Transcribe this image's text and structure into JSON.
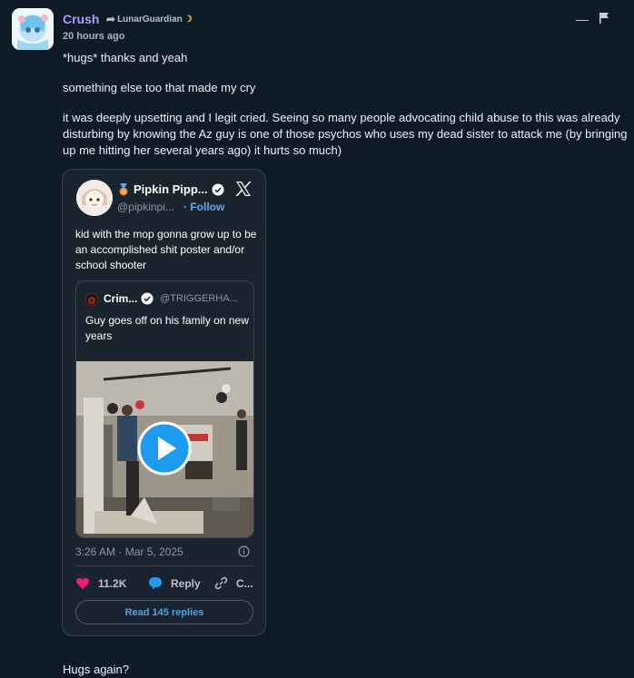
{
  "post": {
    "author": "Crush",
    "reply_to": "LunarGuardian",
    "timestamp": "20 hours ago",
    "messages": [
      "*hugs* thanks and yeah",
      "something else too that made my cry",
      "it was deeply upsetting and I legit cried. Seeing so many people advocating child abuse to this was already disturbing by knowing the Az guy is one of those psychos who uses my dead sister to attack me (by bringing up me hitting her several years ago) it hurts so much)",
      "Hugs again?"
    ],
    "icons": [
      "reply-arrow-icon",
      "moon-icon",
      "minimize-icon",
      "flag-icon"
    ]
  },
  "embed": {
    "name": "Pipkin Pipp...",
    "handle": "@pipkinpi...",
    "follow_label": "· Follow",
    "text": "kid with the mop gonna grow up to be an accomplished shit poster and/or school shooter",
    "quote": {
      "name": "Crim...",
      "handle": "@TRIGGERHA...",
      "text": "Guy goes off on his family on new years"
    },
    "timestamp": "3:26 AM · Mar 5, 2025",
    "likes": "11.2K",
    "reply_label": "Reply",
    "copy_label": "C...",
    "read_replies_label": "Read 145 replies"
  },
  "colors": {
    "background": "#0e1b26",
    "author": "#a79cff",
    "link": "#4fa3e6",
    "like": "#f91880",
    "verified": "#ffffff"
  }
}
